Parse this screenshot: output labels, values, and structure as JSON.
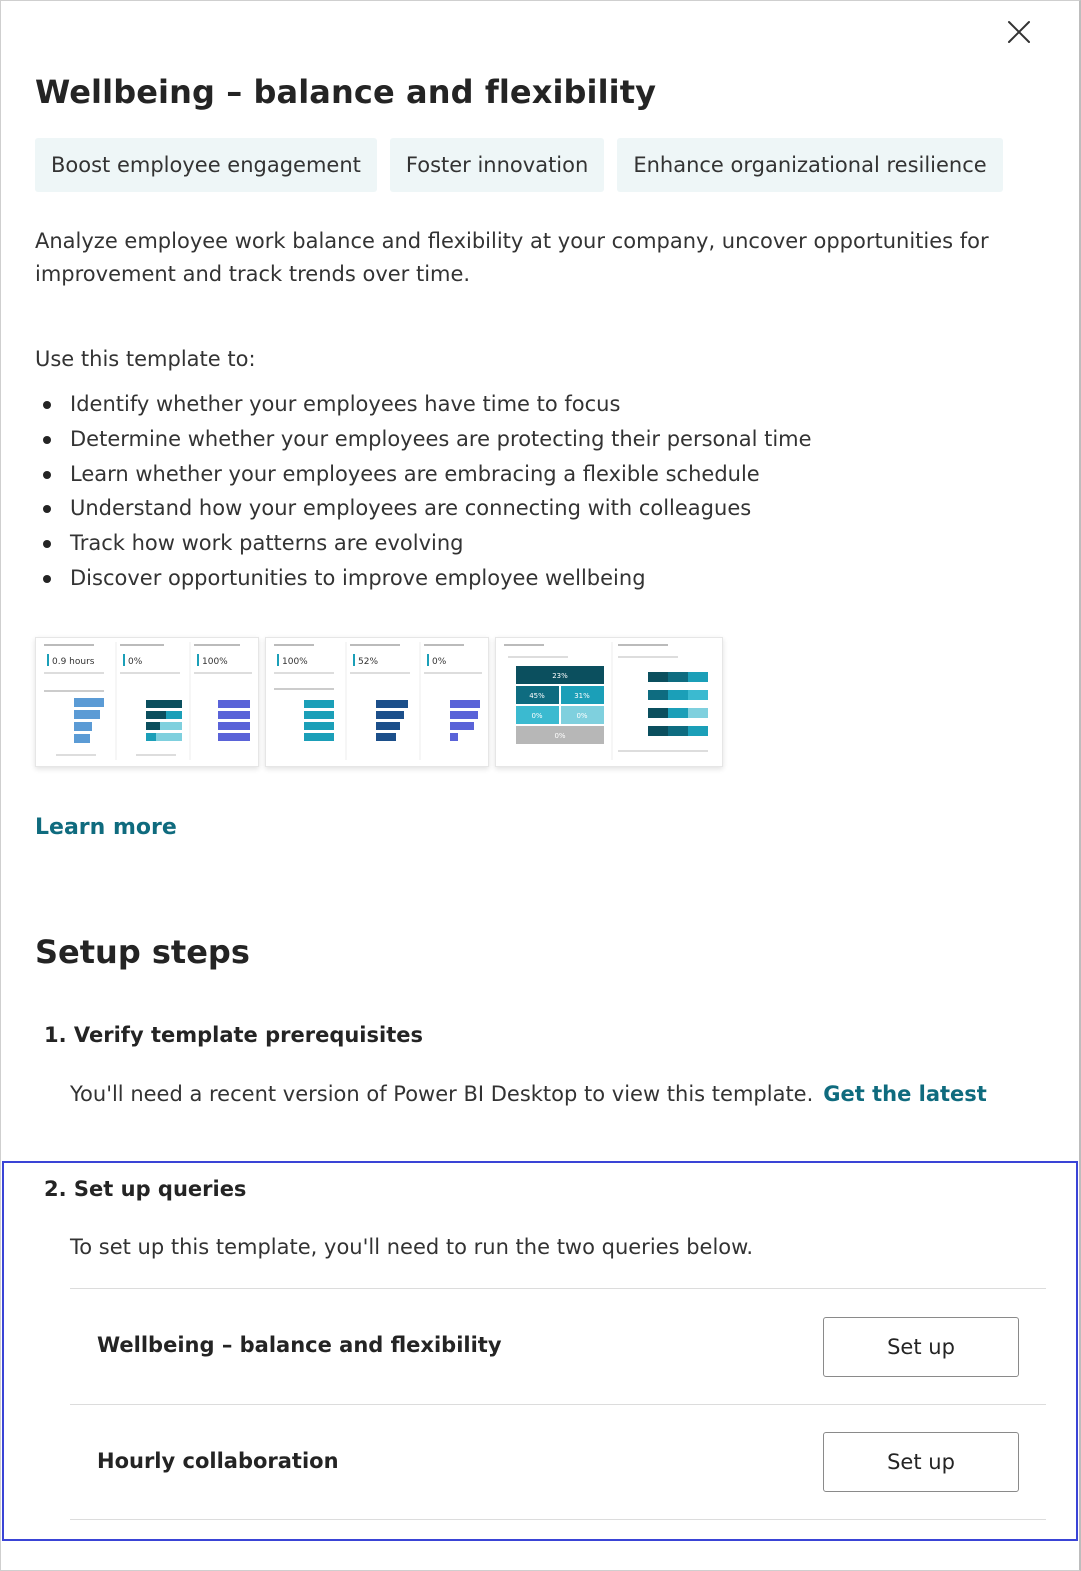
{
  "dialog": {
    "title": "Wellbeing – balance and flexibility",
    "close_icon": "close-icon",
    "tags": [
      "Boost employee engagement",
      "Foster innovation",
      "Enhance organizational resilience"
    ],
    "description": "Analyze employee work balance and flexibility at your company, uncover opportunities for improvement and track trends over time.",
    "use_template_title": "Use this template to:",
    "bullets": [
      "Identify whether your employees have time to focus",
      "Determine whether your employees are protecting their personal time",
      "Learn whether your employees are embracing a flexible schedule",
      "Understand how your employees are connecting with colleagues",
      "Track how work patterns are evolving",
      "Discover opportunities to improve employee wellbeing"
    ],
    "preview_thumbnails": {
      "thumb1_values": [
        "0.9 hours",
        "0%",
        "100%"
      ],
      "thumb2_values": [
        "100%",
        "52%",
        "0%"
      ],
      "thumb3_values": [
        "23%",
        "45%",
        "31%",
        "0%",
        "0%",
        "0%"
      ]
    },
    "learn_more": "Learn more"
  },
  "setup": {
    "title": "Setup steps",
    "step1": {
      "title": "1. Verify template prerequisites",
      "text": "You'll need a recent version of Power BI Desktop to view this template.",
      "link": "Get the latest"
    },
    "step2": {
      "title": "2. Set up queries",
      "text": "To set up this template, you'll need to run the two queries below.",
      "queries": [
        {
          "name": "Wellbeing – balance and flexibility",
          "button": "Set up"
        },
        {
          "name": "Hourly collaboration",
          "button": "Set up"
        }
      ]
    }
  },
  "colors": {
    "accent_link": "#0f6b7e",
    "tag_bg": "#eef6f7",
    "highlight_border": "#3a44d6",
    "thumb_blue_light": "#5b9bd5",
    "thumb_teal": "#1b9fb8",
    "thumb_dark_teal": "#0b4f5e",
    "thumb_purple": "#5a63d8"
  }
}
